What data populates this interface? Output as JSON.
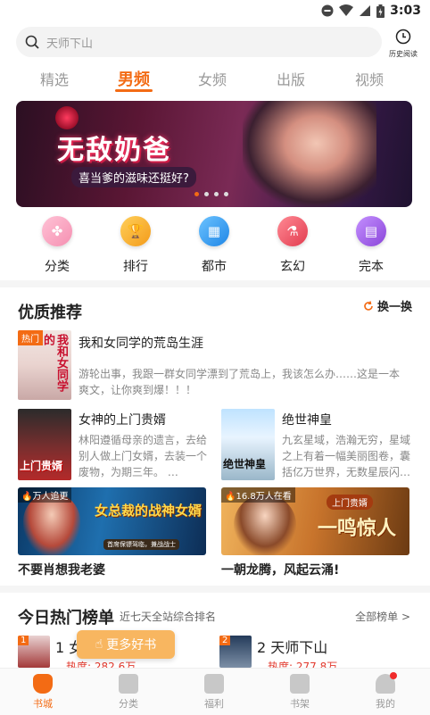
{
  "status_bar": {
    "time": "3:03"
  },
  "search": {
    "placeholder": "天师下山"
  },
  "history": {
    "label": "历史阅读"
  },
  "tabs": [
    {
      "label": "精选",
      "active": false
    },
    {
      "label": "男频",
      "active": true
    },
    {
      "label": "女频",
      "active": false
    },
    {
      "label": "出版",
      "active": false
    },
    {
      "label": "视频",
      "active": false
    }
  ],
  "banner": {
    "title": "无敌奶爸",
    "subtitle": "喜当爹的滋味还挺好?",
    "page_count": 4,
    "current_page": 1
  },
  "categories": [
    {
      "label": "分类",
      "icon": "clover-icon",
      "color": "#f7a9c4"
    },
    {
      "label": "排行",
      "icon": "trophy-icon",
      "color": "#f5a623"
    },
    {
      "label": "都市",
      "icon": "building-icon",
      "color": "#3d9df2"
    },
    {
      "label": "玄幻",
      "icon": "potion-icon",
      "color": "#ef5a6a"
    },
    {
      "label": "完本",
      "icon": "book-icon",
      "color": "#9b5de5"
    }
  ],
  "quality": {
    "title": "优质推荐",
    "refresh_label": "换一换",
    "featured": {
      "badge": "热门",
      "title": "我和女同学的荒岛生涯",
      "desc": "游轮出事，我跟一群女同学漂到了荒岛上，我该怎么办……这是一本爽文，让你爽到爆！！！",
      "cover_text": "我和女同学的"
    },
    "books": [
      {
        "title": "女神的上门贵婿",
        "desc": "林阳遵循母亲的遗言，去给别人做上门女婿，去装一个废物，为期三年。 …",
        "cover_text": "上门贵婿"
      },
      {
        "title": "绝世神皇",
        "desc": "九玄星域，浩瀚无穷，星域之上有着一幅美丽图卷，囊括亿万世界，无数星辰闪…",
        "cover_text": "绝世神皇"
      }
    ],
    "banners": [
      {
        "badge": "万人追更",
        "art_text": "女总裁的战神女婿",
        "tagline": "首席保镖驾临，兼战战士",
        "caption": "不要肖想我老婆"
      },
      {
        "badge": "16.8万人在看",
        "art_text": "一鸣惊人",
        "tagline": "上门贵婿",
        "caption": "一朝龙腾，风起云涌!"
      }
    ]
  },
  "hot_list": {
    "title": "今日热门榜单",
    "subtitle": "近七天全站综合排名",
    "all_label": "全部榜单 >",
    "items": [
      {
        "rank": "1",
        "title": "1 女",
        "heat": "热度: 282.6万"
      },
      {
        "rank": "2",
        "title": "2 天师下山",
        "heat": "热度: 277.8万"
      }
    ]
  },
  "float_button": {
    "label": "更多好书"
  },
  "bottom_nav": [
    {
      "label": "书城",
      "active": true
    },
    {
      "label": "分类",
      "active": false
    },
    {
      "label": "福利",
      "active": false
    },
    {
      "label": "书架",
      "active": false
    },
    {
      "label": "我的",
      "active": false,
      "notification": true
    }
  ]
}
